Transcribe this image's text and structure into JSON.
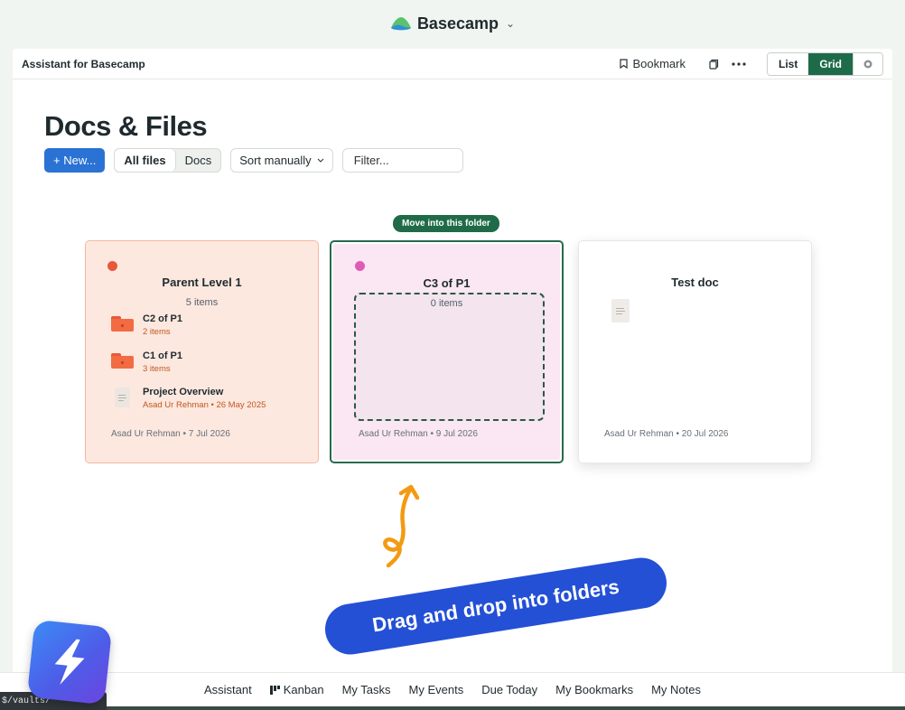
{
  "switcher": {
    "brand": "Basecamp",
    "chevron": "⌄"
  },
  "header": {
    "title": "Assistant for Basecamp",
    "bookmark_label": "Bookmark",
    "view_list": "List",
    "view_grid": "Grid"
  },
  "page": {
    "title": "Docs & Files",
    "new_button": "+ New...",
    "tabs": [
      "All files",
      "Docs"
    ],
    "sort_label": "Sort manually",
    "filter_placeholder": "Filter..."
  },
  "drag": {
    "badge": "Move into this folder"
  },
  "cards": [
    {
      "title": "Parent Level 1",
      "count": "5 items",
      "color": "#e8573a",
      "items": [
        {
          "name": "C2 of P1",
          "sub": "2 items",
          "type": "folder"
        },
        {
          "name": "C1 of P1",
          "sub": "3 items",
          "type": "folder"
        },
        {
          "name": "Project Overview",
          "sub": "Asad Ur Rehman • 26 May 2025",
          "type": "doc"
        }
      ],
      "meta": "Asad Ur Rehman • 7 Jul 2026"
    },
    {
      "title": "C3 of P1",
      "count": "0 items",
      "color": "#de5cb6",
      "meta": "Asad Ur Rehman • 9 Jul 2026"
    },
    {
      "title": "Test doc",
      "meta": "Asad Ur Rehman • 20 Jul 2026"
    }
  ],
  "annotation": {
    "text": "Drag and drop into folders"
  },
  "bottom_nav": [
    "Assistant",
    "Kanban",
    "My Tasks",
    "My Events",
    "Due Today",
    "My Bookmarks",
    "My Notes"
  ],
  "status_url": "$/vaults/",
  "colors": {
    "accent": "#1e6b4a",
    "primary": "#2a72d4",
    "annotation": "#2450d6",
    "arrow": "#f39a12"
  }
}
